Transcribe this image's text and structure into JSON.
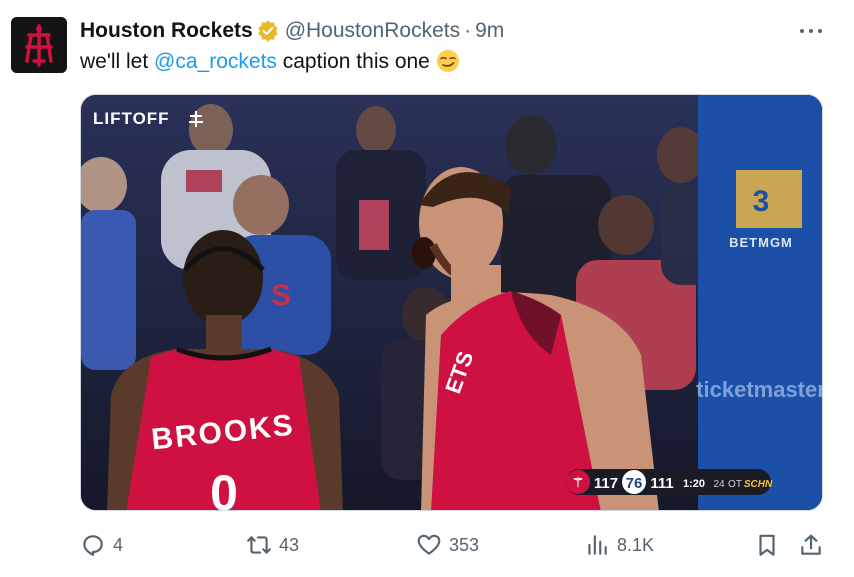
{
  "tweet": {
    "author_name": "Houston Rockets",
    "handle": "@HoustonRockets",
    "separator": "·",
    "time": "9m",
    "text_before": "we'll let ",
    "mention": "@ca_rockets",
    "text_after": " caption this one",
    "emoji": "smirking-face"
  },
  "media": {
    "watermark": "LIFTOFF",
    "jersey_name": "BROOKS",
    "jersey_number": "0",
    "jersey_partial": "ETS",
    "sponsor_board": "BETMGM",
    "board_text": "ticketmaster",
    "scorebug": {
      "home_score": "117",
      "away_score": "111",
      "clock": "1:20",
      "shot_clock": "24",
      "period": "OT",
      "network": "SCHN"
    }
  },
  "actions": {
    "replies": "4",
    "reposts": "43",
    "likes": "353",
    "views": "8.1K"
  },
  "colors": {
    "accent": "#1d9bf0",
    "verified": "#e8b829",
    "rockets_red": "#ce1141",
    "muted": "#536471"
  }
}
